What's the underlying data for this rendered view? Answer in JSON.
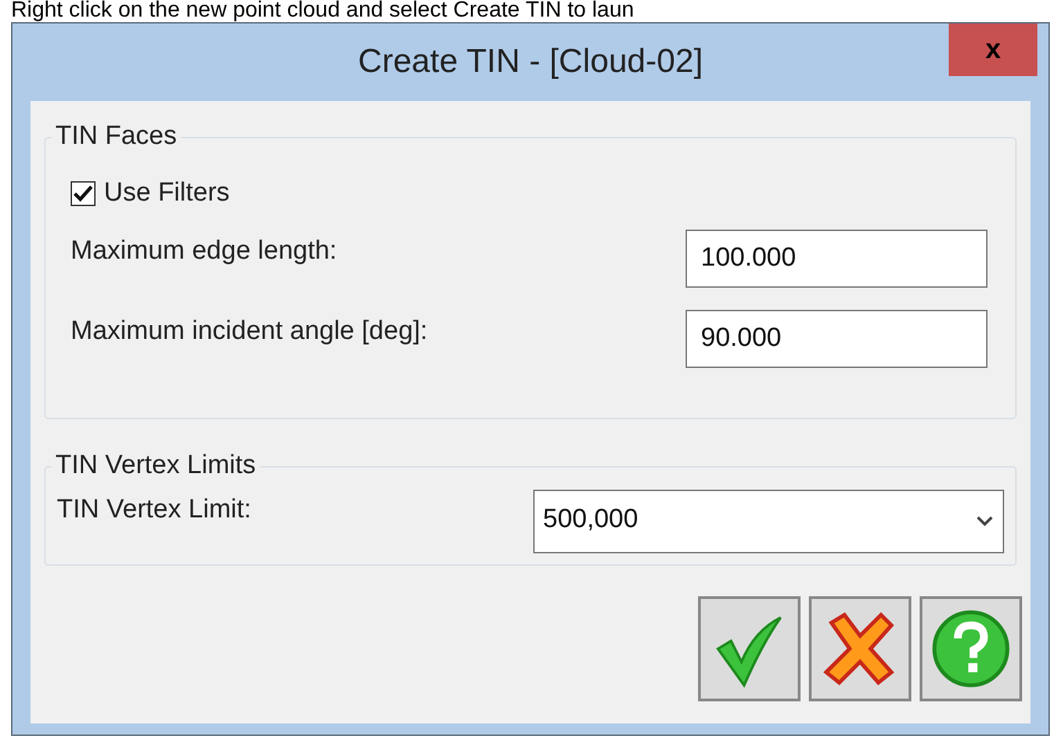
{
  "caption": "Right click on the new point cloud and select Create TIN to laun",
  "window": {
    "title": "Create TIN - [Cloud-02]",
    "close": "x"
  },
  "tin_faces": {
    "title": "TIN Faces",
    "use_filters": {
      "label": "Use Filters",
      "checked": true
    },
    "fields": [
      {
        "label": "Maximum edge length:",
        "value": "100.000"
      },
      {
        "label": "Maximum incident angle [deg]:",
        "value": "90.000"
      }
    ]
  },
  "tin_vertex_limits": {
    "title": "TIN Vertex Limits",
    "label": "TIN Vertex Limit:",
    "value": "500,000"
  },
  "buttons": [
    {
      "kind": "ok"
    },
    {
      "kind": "cancel"
    },
    {
      "kind": "help"
    }
  ]
}
